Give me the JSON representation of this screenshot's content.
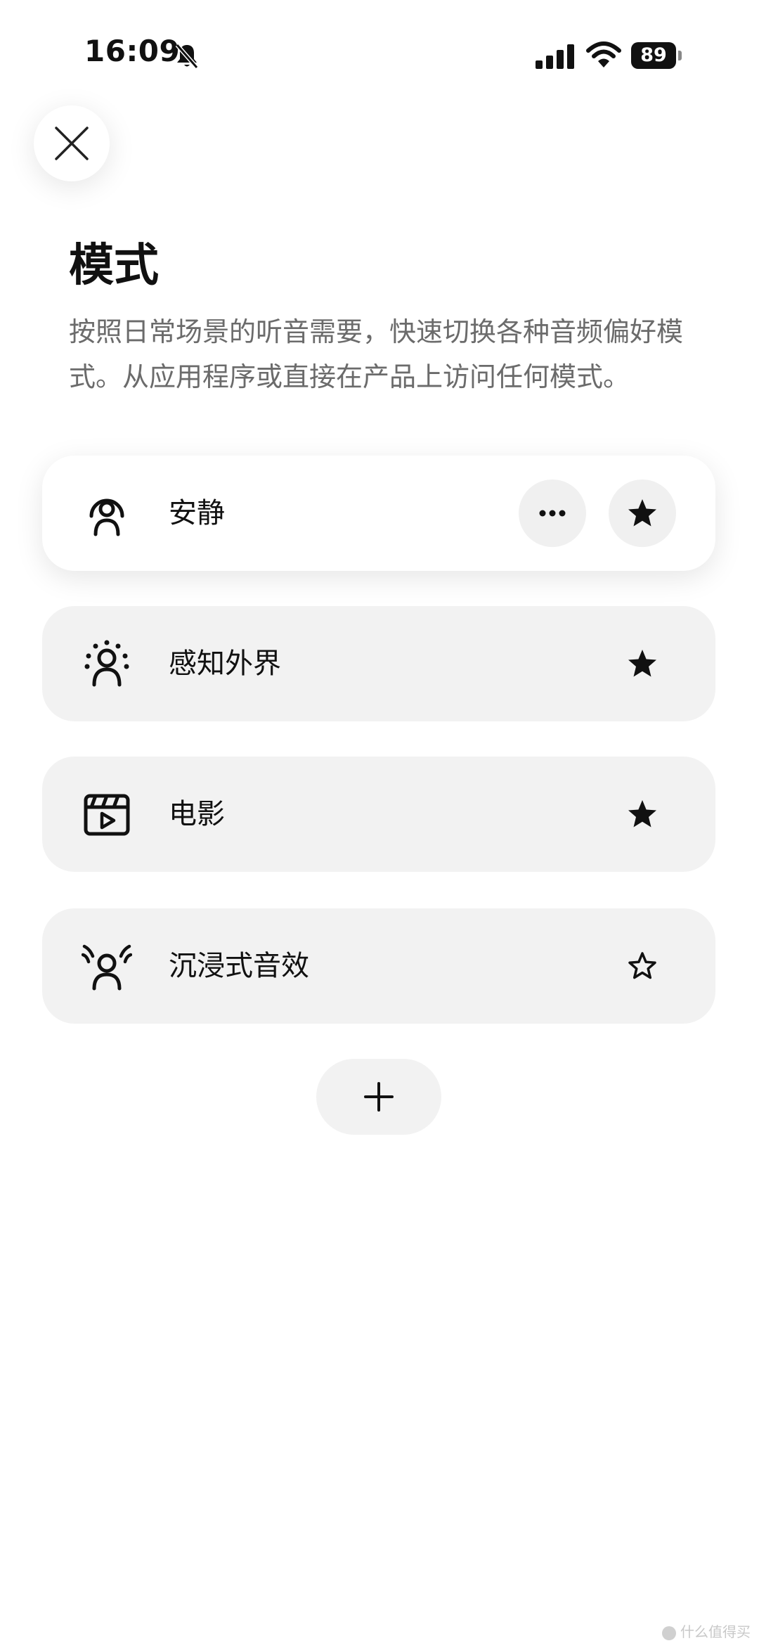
{
  "status_bar": {
    "time": "16:09",
    "battery_level": "89",
    "icons": [
      "bell-slash-icon",
      "cellular-signal-icon",
      "wifi-icon",
      "battery-icon"
    ]
  },
  "header": {
    "close_icon": "close-icon",
    "title": "模式",
    "description": "按照日常场景的听音需要，快速切换各种音频偏好模式。从应用程序或直接在产品上访问任何模式。"
  },
  "modes": [
    {
      "label": "安静",
      "icon": "quiet-mode-icon",
      "active": true,
      "favorite": true,
      "has_more": true
    },
    {
      "label": "感知外界",
      "icon": "aware-mode-icon",
      "active": false,
      "favorite": true,
      "has_more": false
    },
    {
      "label": "电影",
      "icon": "movie-mode-icon",
      "active": false,
      "favorite": true,
      "has_more": false
    },
    {
      "label": "沉浸式音效",
      "icon": "immersive-mode-icon",
      "active": false,
      "favorite": false,
      "has_more": false
    }
  ],
  "add_button": {
    "icon": "plus-icon"
  },
  "watermark": {
    "text": "什么值得买"
  },
  "colors": {
    "background": "#ffffff",
    "card_background": "#f2f2f2",
    "text_primary": "#111111",
    "text_secondary": "#6b6b6b"
  }
}
